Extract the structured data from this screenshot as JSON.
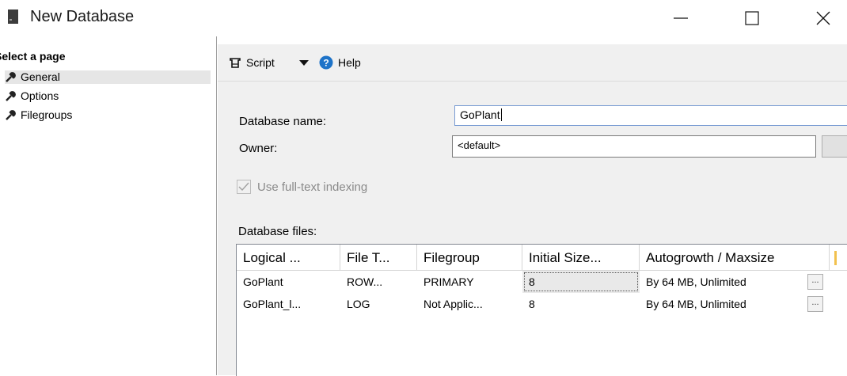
{
  "window": {
    "title": "New Database"
  },
  "left_panel": {
    "header": "Select a page",
    "items": [
      {
        "label": "General",
        "icon": "wrench-icon"
      },
      {
        "label": "Options",
        "icon": "wrench-icon"
      },
      {
        "label": "Filegroups",
        "icon": "wrench-icon"
      }
    ]
  },
  "toolbar": {
    "script_label": "Script",
    "help_label": "Help",
    "help_color": "#1e73c8"
  },
  "form": {
    "db_name_label": "Database name:",
    "db_name_value": "GoPlant",
    "owner_label": "Owner:",
    "owner_value": "<default>",
    "fulltext_label": "Use full-text indexing",
    "fulltext_checked": true,
    "db_files_label": "Database files:"
  },
  "grid": {
    "columns": [
      "Logical ...",
      "File T...",
      "Filegroup",
      "Initial Size...",
      "Autogrowth / Maxsize"
    ],
    "rows": [
      {
        "logical": "GoPlant",
        "file_type": "ROW...",
        "filegroup": "PRIMARY",
        "initial_size": "8",
        "autogrowth": "By 64 MB, Unlimited",
        "button": "..."
      },
      {
        "logical": "GoPlant_l...",
        "file_type": "LOG",
        "filegroup": "Not Applic...",
        "initial_size": "8",
        "autogrowth": "By 64 MB, Unlimited",
        "button": "..."
      }
    ]
  }
}
